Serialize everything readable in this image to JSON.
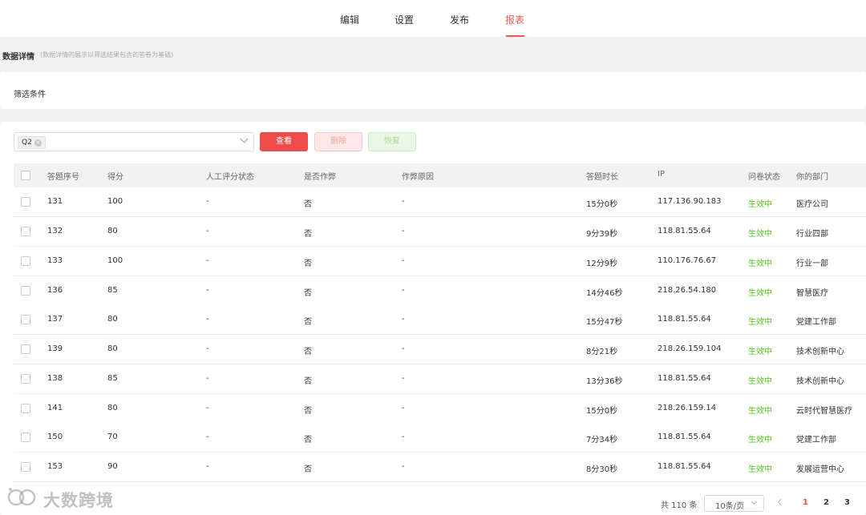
{
  "nav": {
    "tabs": [
      "编辑",
      "设置",
      "发布",
      "报表"
    ],
    "active_tab": "报表"
  },
  "section": {
    "title": "数据详情",
    "note": "(数据详情的展示以筛选结果包含的答卷为基础)"
  },
  "filter": {
    "label": "筛选条件",
    "selected_tag": "Q2"
  },
  "buttons": {
    "view": "查看",
    "delete": "删除",
    "restore": "恢复"
  },
  "table": {
    "headers": [
      "答题序号",
      "得分",
      "人工评分状态",
      "是否作弊",
      "作弊原因",
      "答题时长",
      "IP",
      "问卷状态",
      "你的部门"
    ],
    "rows": [
      [
        "131",
        "100",
        "-",
        "否",
        "-",
        "15分0秒",
        "117.136.90.183",
        "生效中",
        "医疗公司"
      ],
      [
        "132",
        "80",
        "-",
        "否",
        "-",
        "9分39秒",
        "118.81.55.64",
        "生效中",
        "行业四部"
      ],
      [
        "133",
        "100",
        "-",
        "否",
        "-",
        "12分9秒",
        "110.176.76.67",
        "生效中",
        "行业一部"
      ],
      [
        "136",
        "85",
        "-",
        "否",
        "-",
        "14分46秒",
        "218.26.54.180",
        "生效中",
        "智慧医疗"
      ],
      [
        "137",
        "80",
        "-",
        "否",
        "-",
        "15分47秒",
        "118.81.55.64",
        "生效中",
        "党建工作部"
      ],
      [
        "139",
        "80",
        "-",
        "否",
        "-",
        "8分21秒",
        "218.26.159.104",
        "生效中",
        "技术创新中心"
      ],
      [
        "138",
        "85",
        "-",
        "否",
        "-",
        "13分36秒",
        "118.81.55.64",
        "生效中",
        "技术创新中心"
      ],
      [
        "141",
        "80",
        "-",
        "否",
        "-",
        "15分0秒",
        "218.26.159.14",
        "生效中",
        "云时代智慧医疗"
      ],
      [
        "150",
        "70",
        "-",
        "否",
        "-",
        "7分34秒",
        "118.81.55.64",
        "生效中",
        "党建工作部"
      ],
      [
        "153",
        "90",
        "-",
        "否",
        "-",
        "8分30秒",
        "118.81.55.64",
        "生效中",
        "发展运营中心"
      ]
    ]
  },
  "pagination": {
    "total": "共 110 条",
    "page_size": "10条/页",
    "pages": [
      "1",
      "2",
      "3"
    ],
    "current_page": "1"
  },
  "watermark": {
    "text": "大数跨境"
  },
  "colors": {
    "accent": "#f04b4b",
    "status_active": "#52c41a"
  }
}
